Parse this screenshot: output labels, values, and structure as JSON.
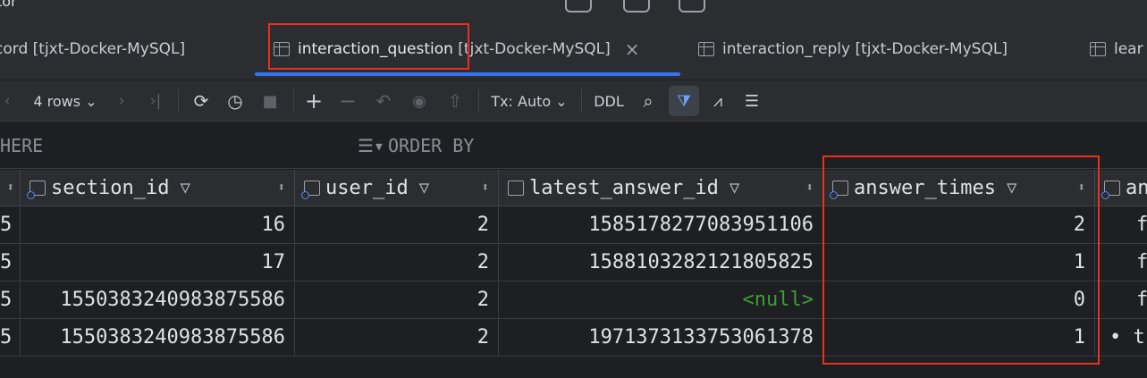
{
  "window": {
    "title_fragment": "tor"
  },
  "tabs": [
    {
      "label": "cord",
      "source": "[tjxt-Docker-MySQL]"
    },
    {
      "label": "interaction_question",
      "source": "[tjxt-Docker-MySQL]",
      "close": "×"
    },
    {
      "label": "interaction_reply",
      "source": "[tjxt-Docker-MySQL]"
    },
    {
      "label": "lear",
      "source": ""
    }
  ],
  "toolbar": {
    "rows": "4 rows",
    "tx_mode": "Tx: Auto",
    "ddl": "DDL"
  },
  "filter": {
    "where": "HERE",
    "order_by": "ORDER BY"
  },
  "columns": [
    {
      "name": ""
    },
    {
      "name": "section_id"
    },
    {
      "name": "user_id"
    },
    {
      "name": "latest_answer_id"
    },
    {
      "name": "answer_times"
    },
    {
      "name": "an"
    }
  ],
  "rows": [
    [
      "5",
      "16",
      "2",
      "1585178277083951106",
      "2",
      "f"
    ],
    [
      "5",
      "17",
      "2",
      "1588103282121805825",
      "1",
      "f"
    ],
    [
      "5",
      "1550383240983875586",
      "2",
      "<null>",
      "0",
      "f"
    ],
    [
      "5",
      "1550383240983875586",
      "2",
      "1971373133753061378",
      "1",
      "• t"
    ]
  ],
  "colors": {
    "accent": "#3574f0",
    "highlight": "#e8311f",
    "null_text": "#3c9d37"
  }
}
